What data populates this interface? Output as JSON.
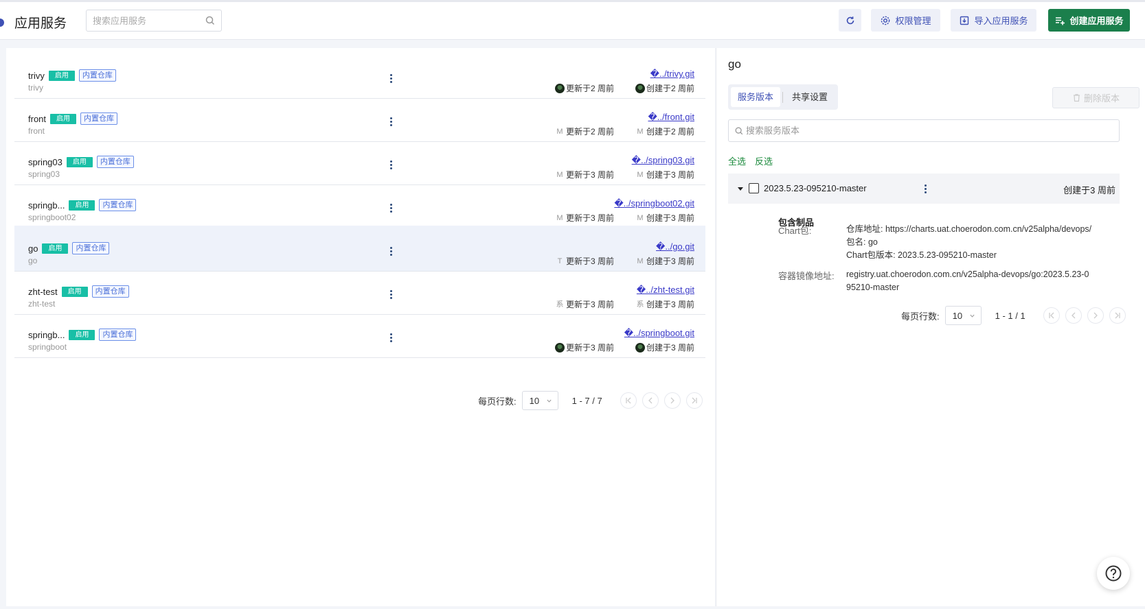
{
  "header": {
    "title": "应用服务",
    "search_placeholder": "搜索应用服务",
    "permission_label": "权限管理",
    "import_label": "导入应用服务",
    "create_label": "创建应用服务"
  },
  "services": [
    {
      "name": "trivy",
      "code": "trivy",
      "status": "启用",
      "repo_tag": "内置仓库",
      "repo": "�../trivy.git",
      "updated_avatar": "",
      "updated": "更新于2 周前",
      "created_avatar": "",
      "created": "创建于2 周前"
    },
    {
      "name": "front",
      "code": "front",
      "status": "启用",
      "repo_tag": "内置仓库",
      "repo": "�../front.git",
      "updated_avatar": "M",
      "updated": "更新于2 周前",
      "created_avatar": "M",
      "created": "创建于2 周前"
    },
    {
      "name": "spring03",
      "code": "spring03",
      "status": "启用",
      "repo_tag": "内置仓库",
      "repo": "�../spring03.git",
      "updated_avatar": "M",
      "updated": "更新于3 周前",
      "created_avatar": "M",
      "created": "创建于3 周前"
    },
    {
      "name": "springb...",
      "code": "springboot02",
      "status": "启用",
      "repo_tag": "内置仓库",
      "repo": "�../springboot02.git",
      "updated_avatar": "M",
      "updated": "更新于3 周前",
      "created_avatar": "M",
      "created": "创建于3 周前"
    },
    {
      "name": "go",
      "code": "go",
      "status": "启用",
      "repo_tag": "内置仓库",
      "repo": "�../go.git",
      "updated_avatar": "T",
      "updated": "更新于3 周前",
      "created_avatar": "M",
      "created": "创建于3 周前"
    },
    {
      "name": "zht-test",
      "code": "zht-test",
      "status": "启用",
      "repo_tag": "内置仓库",
      "repo": "�../zht-test.git",
      "updated_avatar": "系",
      "updated": "更新于3 周前",
      "created_avatar": "系",
      "created": "创建于3 周前"
    },
    {
      "name": "springb...",
      "code": "springboot",
      "status": "启用",
      "repo_tag": "内置仓库",
      "repo": "�../springboot.git",
      "updated_avatar": "",
      "updated": "更新于3 周前",
      "created_avatar": "",
      "created": "创建于3 周前"
    }
  ],
  "list_pager": {
    "rows_label": "每页行数:",
    "page_size": "10",
    "range": "1 - 7 / 7"
  },
  "detail": {
    "title": "go",
    "tabs": [
      "服务版本",
      "共享设置"
    ],
    "delete_label": "删除版本",
    "search_placeholder": "搜索服务版本",
    "select_all": "全选",
    "invert": "反选",
    "version": {
      "name": "2023.5.23-095210-master",
      "created": "创建于3 周前",
      "artifacts_title": "包含制品",
      "chart_label": "Chart包:",
      "chart_repo": "仓库地址: https://charts.uat.choerodon.com.cn/v25alpha/devops/",
      "chart_name": "包名: go",
      "chart_version": "Chart包版本: 2023.5.23-095210-master",
      "image_label": "容器镜像地址:",
      "image_value": "registry.uat.choerodon.com.cn/v25alpha-devops/go:2023.5.23-095210-master"
    },
    "pager": {
      "rows_label": "每页行数:",
      "page_size": "10",
      "range": "1 - 1 / 1"
    }
  },
  "colors": {
    "primary": "#3f51b5",
    "create_button": "#1b7f4c",
    "enabled_badge": "#18bfa6",
    "link_green": "#1b8a3c"
  },
  "icons": [
    "search-icon",
    "refresh-icon",
    "gear-icon",
    "import-icon",
    "add-list-icon",
    "more-icon",
    "chevron-down-icon",
    "first-page-icon",
    "prev-page-icon",
    "next-page-icon",
    "last-page-icon",
    "help-icon"
  ]
}
